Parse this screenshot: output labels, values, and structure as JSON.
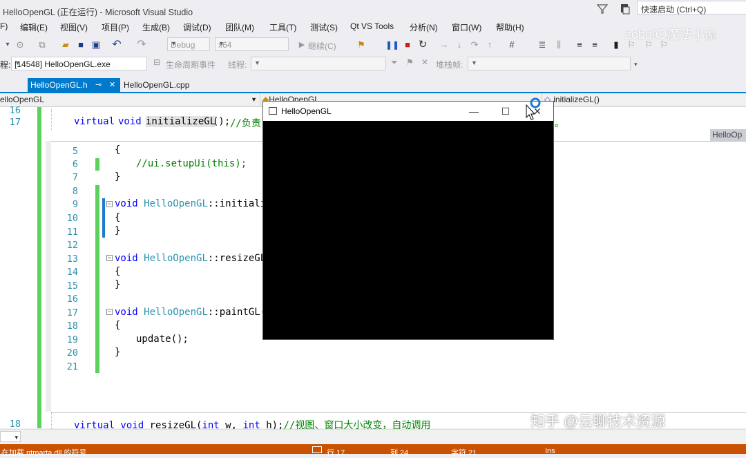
{
  "window": {
    "title": "HelloOpenGL (正在运行) - Microsoft Visual Studio",
    "quick_launch_placeholder": "快速启动 (Ctrl+Q)"
  },
  "menu": [
    "F)",
    "编辑(E)",
    "视图(V)",
    "项目(P)",
    "生成(B)",
    "调试(D)",
    "团队(M)",
    "工具(T)",
    "测试(S)",
    "Qt VS Tools",
    "分析(N)",
    "窗口(W)",
    "帮助(H)"
  ],
  "watermark_top": "zobolの魔法小屋",
  "toolbar": {
    "config": "Debug",
    "platform": "x64",
    "continue_label": "继续(C)"
  },
  "process_bar": {
    "label": "程:",
    "process": "[14548] HelloOpenGL.exe",
    "lifecycle": "生命周期事件",
    "thread_label": "线程:",
    "stack_label": "堆栈帧:"
  },
  "tabs": [
    {
      "label": "HelloOpenGL.h",
      "active": true
    },
    {
      "label": "HelloOpenGL.cpp",
      "active": false
    }
  ],
  "nav": {
    "project": "elloOpenGL",
    "class": "HelloOpenGL",
    "member": "initializeGL()"
  },
  "editor": {
    "outer_lines": [
      {
        "num": "16"
      },
      {
        "num": "17",
        "code_virtual": "virtual",
        "code_void": "void",
        "code_fn": "initializeGL",
        "code_rest": "();",
        "code_comment": "//负责"
      },
      {
        "num": "18",
        "code": "virtual void resizeGL(int w, int h);//视图、窗口大小改变，自动调用"
      }
    ],
    "peek_tab": "HelloOp",
    "outer_tail": "。",
    "peek_lines": [
      {
        "num": "5",
        "text": "{"
      },
      {
        "num": "6",
        "text": "//ui.setupUi(this);"
      },
      {
        "num": "7",
        "text": "}"
      },
      {
        "num": "8",
        "text": ""
      },
      {
        "num": "9",
        "text": "void HelloOpenGL::initializ"
      },
      {
        "num": "10",
        "text": "{"
      },
      {
        "num": "11",
        "text": "}"
      },
      {
        "num": "12",
        "text": ""
      },
      {
        "num": "13",
        "text": "void HelloOpenGL::resizeGL("
      },
      {
        "num": "14",
        "text": "{"
      },
      {
        "num": "15",
        "text": "}"
      },
      {
        "num": "16",
        "text": ""
      },
      {
        "num": "17",
        "text": "void HelloOpenGL::paintGL()"
      },
      {
        "num": "18",
        "text": "{"
      },
      {
        "num": "19",
        "text": "update();"
      },
      {
        "num": "20",
        "text": "}"
      },
      {
        "num": "21",
        "text": ""
      }
    ]
  },
  "gl_window": {
    "title": "HelloOpenGL",
    "min": "—",
    "max": "☐",
    "close": "✕"
  },
  "watermark_bottom": "知乎 @云聊技术资源",
  "status": {
    "left": "在加载 ntmarta.dll 的符号",
    "line": "行 17",
    "col": "列 24",
    "char": "字符 21",
    "mode": "Ins"
  },
  "colors": {
    "accent": "#007acc",
    "status_bg": "#ca5100",
    "keyword": "#0000ff",
    "type": "#2b91af",
    "comment": "#008000",
    "change_bar": "#5cd25c"
  }
}
